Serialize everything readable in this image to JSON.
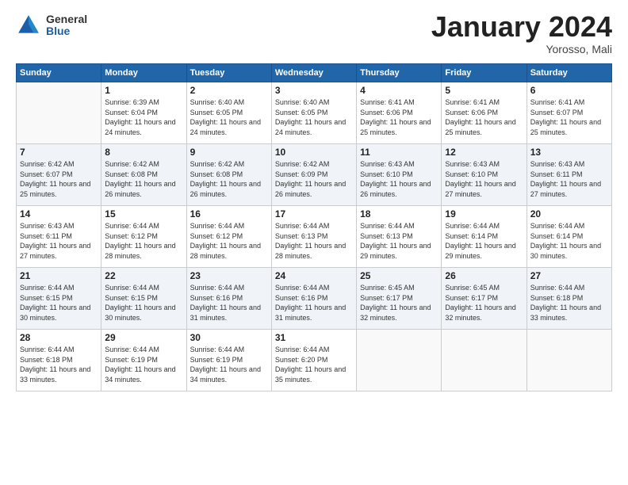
{
  "logo": {
    "general": "General",
    "blue": "Blue"
  },
  "title": {
    "month": "January 2024",
    "location": "Yorosso, Mali"
  },
  "headers": [
    "Sunday",
    "Monday",
    "Tuesday",
    "Wednesday",
    "Thursday",
    "Friday",
    "Saturday"
  ],
  "weeks": [
    [
      {
        "day": "",
        "sunrise": "",
        "sunset": "",
        "daylight": ""
      },
      {
        "day": "1",
        "sunrise": "Sunrise: 6:39 AM",
        "sunset": "Sunset: 6:04 PM",
        "daylight": "Daylight: 11 hours and 24 minutes."
      },
      {
        "day": "2",
        "sunrise": "Sunrise: 6:40 AM",
        "sunset": "Sunset: 6:05 PM",
        "daylight": "Daylight: 11 hours and 24 minutes."
      },
      {
        "day": "3",
        "sunrise": "Sunrise: 6:40 AM",
        "sunset": "Sunset: 6:05 PM",
        "daylight": "Daylight: 11 hours and 24 minutes."
      },
      {
        "day": "4",
        "sunrise": "Sunrise: 6:41 AM",
        "sunset": "Sunset: 6:06 PM",
        "daylight": "Daylight: 11 hours and 25 minutes."
      },
      {
        "day": "5",
        "sunrise": "Sunrise: 6:41 AM",
        "sunset": "Sunset: 6:06 PM",
        "daylight": "Daylight: 11 hours and 25 minutes."
      },
      {
        "day": "6",
        "sunrise": "Sunrise: 6:41 AM",
        "sunset": "Sunset: 6:07 PM",
        "daylight": "Daylight: 11 hours and 25 minutes."
      }
    ],
    [
      {
        "day": "7",
        "sunrise": "Sunrise: 6:42 AM",
        "sunset": "Sunset: 6:07 PM",
        "daylight": "Daylight: 11 hours and 25 minutes."
      },
      {
        "day": "8",
        "sunrise": "Sunrise: 6:42 AM",
        "sunset": "Sunset: 6:08 PM",
        "daylight": "Daylight: 11 hours and 26 minutes."
      },
      {
        "day": "9",
        "sunrise": "Sunrise: 6:42 AM",
        "sunset": "Sunset: 6:08 PM",
        "daylight": "Daylight: 11 hours and 26 minutes."
      },
      {
        "day": "10",
        "sunrise": "Sunrise: 6:42 AM",
        "sunset": "Sunset: 6:09 PM",
        "daylight": "Daylight: 11 hours and 26 minutes."
      },
      {
        "day": "11",
        "sunrise": "Sunrise: 6:43 AM",
        "sunset": "Sunset: 6:10 PM",
        "daylight": "Daylight: 11 hours and 26 minutes."
      },
      {
        "day": "12",
        "sunrise": "Sunrise: 6:43 AM",
        "sunset": "Sunset: 6:10 PM",
        "daylight": "Daylight: 11 hours and 27 minutes."
      },
      {
        "day": "13",
        "sunrise": "Sunrise: 6:43 AM",
        "sunset": "Sunset: 6:11 PM",
        "daylight": "Daylight: 11 hours and 27 minutes."
      }
    ],
    [
      {
        "day": "14",
        "sunrise": "Sunrise: 6:43 AM",
        "sunset": "Sunset: 6:11 PM",
        "daylight": "Daylight: 11 hours and 27 minutes."
      },
      {
        "day": "15",
        "sunrise": "Sunrise: 6:44 AM",
        "sunset": "Sunset: 6:12 PM",
        "daylight": "Daylight: 11 hours and 28 minutes."
      },
      {
        "day": "16",
        "sunrise": "Sunrise: 6:44 AM",
        "sunset": "Sunset: 6:12 PM",
        "daylight": "Daylight: 11 hours and 28 minutes."
      },
      {
        "day": "17",
        "sunrise": "Sunrise: 6:44 AM",
        "sunset": "Sunset: 6:13 PM",
        "daylight": "Daylight: 11 hours and 28 minutes."
      },
      {
        "day": "18",
        "sunrise": "Sunrise: 6:44 AM",
        "sunset": "Sunset: 6:13 PM",
        "daylight": "Daylight: 11 hours and 29 minutes."
      },
      {
        "day": "19",
        "sunrise": "Sunrise: 6:44 AM",
        "sunset": "Sunset: 6:14 PM",
        "daylight": "Daylight: 11 hours and 29 minutes."
      },
      {
        "day": "20",
        "sunrise": "Sunrise: 6:44 AM",
        "sunset": "Sunset: 6:14 PM",
        "daylight": "Daylight: 11 hours and 30 minutes."
      }
    ],
    [
      {
        "day": "21",
        "sunrise": "Sunrise: 6:44 AM",
        "sunset": "Sunset: 6:15 PM",
        "daylight": "Daylight: 11 hours and 30 minutes."
      },
      {
        "day": "22",
        "sunrise": "Sunrise: 6:44 AM",
        "sunset": "Sunset: 6:15 PM",
        "daylight": "Daylight: 11 hours and 30 minutes."
      },
      {
        "day": "23",
        "sunrise": "Sunrise: 6:44 AM",
        "sunset": "Sunset: 6:16 PM",
        "daylight": "Daylight: 11 hours and 31 minutes."
      },
      {
        "day": "24",
        "sunrise": "Sunrise: 6:44 AM",
        "sunset": "Sunset: 6:16 PM",
        "daylight": "Daylight: 11 hours and 31 minutes."
      },
      {
        "day": "25",
        "sunrise": "Sunrise: 6:45 AM",
        "sunset": "Sunset: 6:17 PM",
        "daylight": "Daylight: 11 hours and 32 minutes."
      },
      {
        "day": "26",
        "sunrise": "Sunrise: 6:45 AM",
        "sunset": "Sunset: 6:17 PM",
        "daylight": "Daylight: 11 hours and 32 minutes."
      },
      {
        "day": "27",
        "sunrise": "Sunrise: 6:44 AM",
        "sunset": "Sunset: 6:18 PM",
        "daylight": "Daylight: 11 hours and 33 minutes."
      }
    ],
    [
      {
        "day": "28",
        "sunrise": "Sunrise: 6:44 AM",
        "sunset": "Sunset: 6:18 PM",
        "daylight": "Daylight: 11 hours and 33 minutes."
      },
      {
        "day": "29",
        "sunrise": "Sunrise: 6:44 AM",
        "sunset": "Sunset: 6:19 PM",
        "daylight": "Daylight: 11 hours and 34 minutes."
      },
      {
        "day": "30",
        "sunrise": "Sunrise: 6:44 AM",
        "sunset": "Sunset: 6:19 PM",
        "daylight": "Daylight: 11 hours and 34 minutes."
      },
      {
        "day": "31",
        "sunrise": "Sunrise: 6:44 AM",
        "sunset": "Sunset: 6:20 PM",
        "daylight": "Daylight: 11 hours and 35 minutes."
      },
      {
        "day": "",
        "sunrise": "",
        "sunset": "",
        "daylight": ""
      },
      {
        "day": "",
        "sunrise": "",
        "sunset": "",
        "daylight": ""
      },
      {
        "day": "",
        "sunrise": "",
        "sunset": "",
        "daylight": ""
      }
    ]
  ]
}
